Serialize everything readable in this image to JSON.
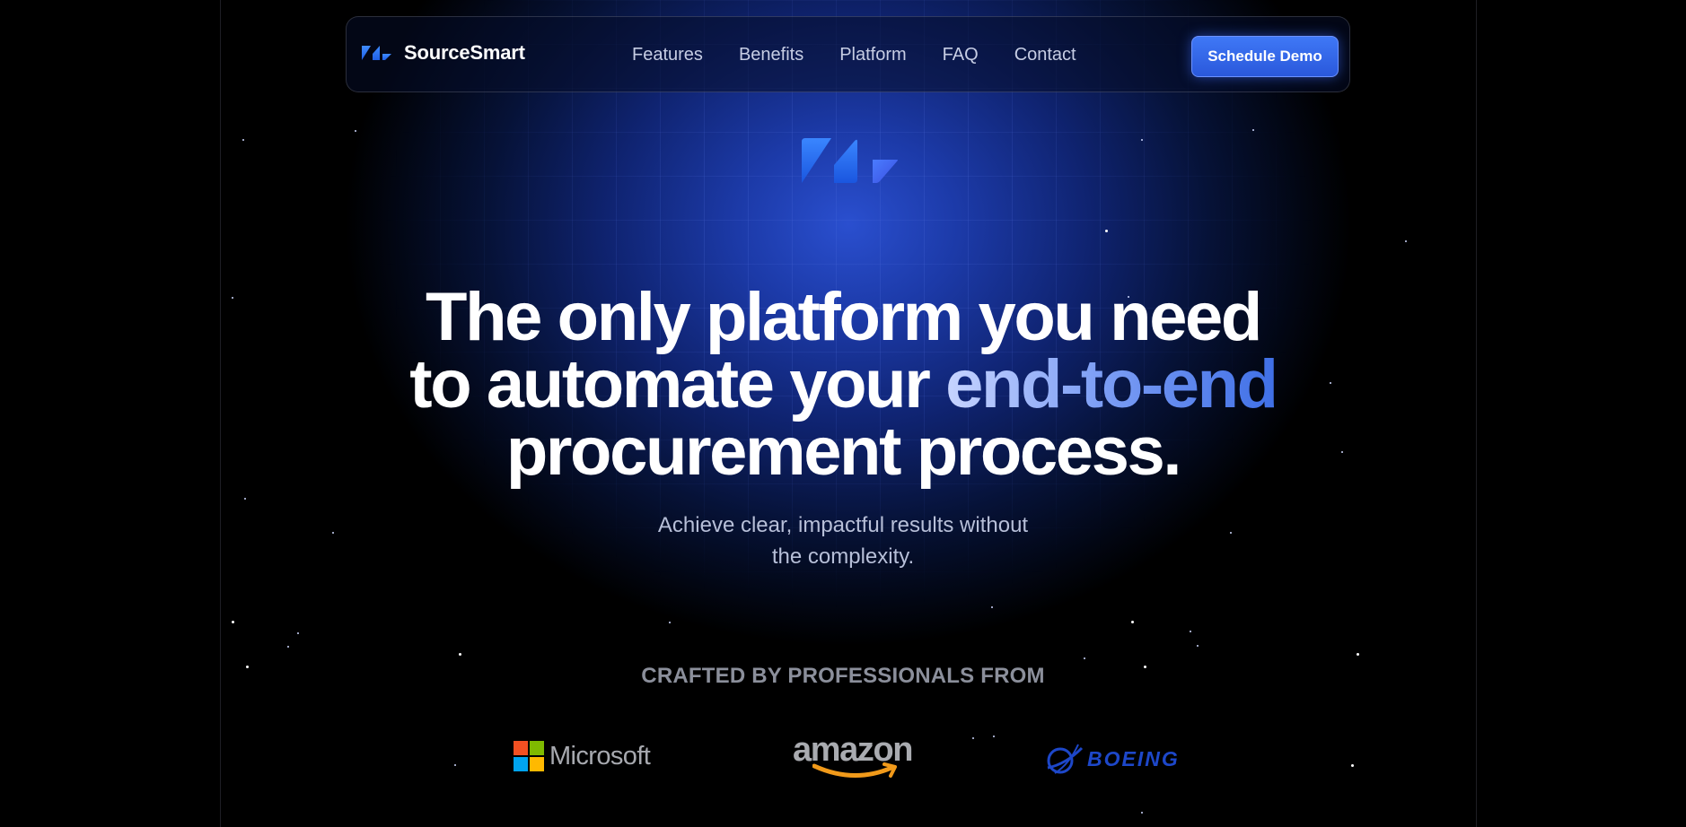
{
  "nav": {
    "brand": "SourceSmart",
    "links": [
      "Features",
      "Benefits",
      "Platform",
      "FAQ",
      "Contact"
    ],
    "cta": "Schedule Demo"
  },
  "hero": {
    "headline_line1": "The only platform you need",
    "headline_line2_start": "to automate your ",
    "headline_line2_accent": "end-to-end",
    "headline_line3": "procurement process.",
    "subtext_line1": "Achieve clear, impactful results without",
    "subtext_line2": "the complexity."
  },
  "trust": {
    "heading": "CRAFTED BY PROFESSIONALS FROM",
    "logos": {
      "microsoft": "Microsoft",
      "amazon": "amazon",
      "boeing": "BOEING"
    }
  },
  "colors": {
    "accent": "#3f78f6",
    "logo_blue": "#1f6bff",
    "background": "#000000"
  }
}
